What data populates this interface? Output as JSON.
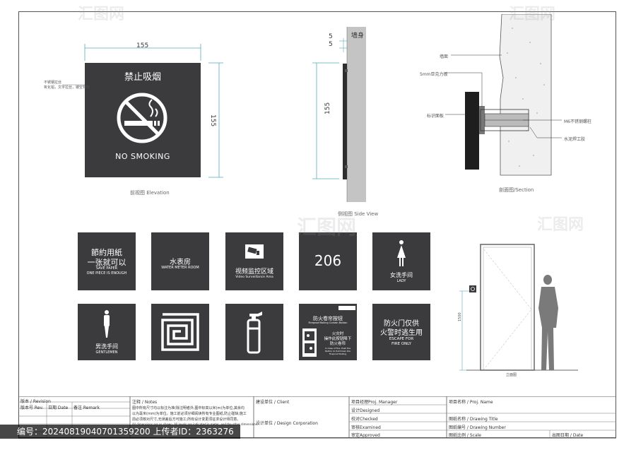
{
  "elevation": {
    "width_dim": "155",
    "height_dim": "155",
    "title_cn": "禁止吸烟",
    "title_en": "NO SMOKING",
    "caption": "前视图 Elevation",
    "note_lines": [
      "不锈钢拉丝",
      "氧化铝，文字拉丝，镂空背灯"
    ]
  },
  "side": {
    "dim_a": "5",
    "dim_b": "5",
    "height_dim": "155",
    "wall_label": "墙身",
    "caption": "侧视图 Side View"
  },
  "section": {
    "labels": [
      "墙面",
      "5mm亚克力板",
      "标识面板",
      "M6不锈钢螺柱",
      "水泥焊工胶"
    ],
    "caption": "剖面图/Section"
  },
  "signs_row1": [
    {
      "lines": [
        "節約用紙",
        "一张就可以"
      ],
      "sub": [
        "SAVE PAPER",
        "ONE PIECE IS ENOUGH"
      ],
      "icon": ""
    },
    {
      "lines": [
        "水表房"
      ],
      "sub": [
        "WATER METER ROOM"
      ],
      "icon": ""
    },
    {
      "lines": [
        "视频监控区域"
      ],
      "sub": [
        "Video Surveillance Area"
      ],
      "icon": "camera-icon"
    },
    {
      "lines": [
        "206"
      ],
      "sub": [],
      "icon": ""
    },
    {
      "lines": [
        "女洗手间"
      ],
      "sub": [
        "LADY"
      ],
      "icon": "woman-icon"
    }
  ],
  "signs_row2": [
    {
      "lines": [
        "男洗手间"
      ],
      "sub": [
        "GENTLEMEN"
      ],
      "icon": "man-icon"
    },
    {
      "lines": [],
      "sub": [],
      "icon": "spiral-icon"
    },
    {
      "lines": [],
      "sub": [],
      "icon": "fire-extinguisher-icon"
    },
    {
      "lines": [
        "防火卷帘按钮"
      ],
      "sub": [
        "Fireproof Rolling Curtain Button"
      ],
      "icon": "button-panel-icon",
      "extra": [
        "火灾时",
        "操作此按钮降下",
        "防火卷帘"
      ],
      "extra_sub": [
        "In Case of Fire, Push the",
        "Button to Pull Down the",
        "Fireproof Rolling"
      ]
    },
    {
      "lines": [
        "防火门仅供",
        "火警时逃生用"
      ],
      "sub": [
        "ESCAPE FOR",
        "FIRE ONLY"
      ],
      "icon": ""
    }
  ],
  "door": {
    "height_dim": "1500",
    "caption": "立面图"
  },
  "title_block": {
    "revision_cn": "版本 / Revision",
    "rev_no": "版本号 Rev.",
    "date": "日期 Date",
    "remark": "备注 Remark",
    "notes_title": "注释 / Notes",
    "notes_text": [
      "图中所有尺寸均以标注为准(除注明者外,图中标高以米(m)为单位,其余均",
      "以为毫米(mm)为单位。施工前必须仔细阅读所有专业图纸,防止碰缺;施工",
      "前必须核对尺寸,无误差后方可施工;所有设计变更须征求设计师同意。",
      "All dimensions are as shown. All levels are indicated in meter, and the other dimensions"
    ],
    "client": "建设单位 / Client",
    "design_corp": "设计单位 / Design Corporation",
    "manager": "项目经理Proj. Manager",
    "designed": "设计Designed",
    "checked": "校对Checked",
    "examined": "审核Examined",
    "approved": "审定Approved",
    "proj_name": "项目名称 / Proj. Name",
    "drawing_title": "图纸名称 / Drawing Title",
    "drawing_number": "图纸编号 / Drawing Number",
    "scale": "图纸比例 / Scale",
    "date_out": "出图日期 / Date"
  },
  "watermark": {
    "text": "汇图网",
    "footer": "编号：20240819040701359200  上传者ID：2363276"
  }
}
